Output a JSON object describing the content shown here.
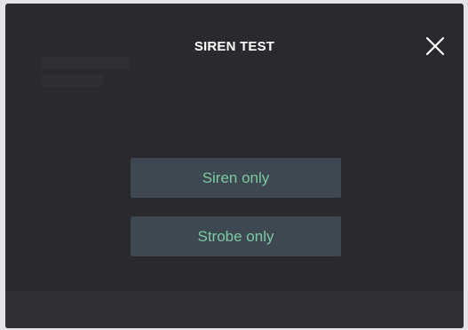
{
  "dialog": {
    "title": "SIREN TEST",
    "close_icon": "close-icon"
  },
  "options": [
    {
      "label": "Siren only"
    },
    {
      "label": "Strobe only"
    }
  ],
  "colors": {
    "background": "#2a2a2e",
    "button_bg": "#3d4852",
    "button_text": "#7dc9a1",
    "title_text": "#ffffff"
  }
}
